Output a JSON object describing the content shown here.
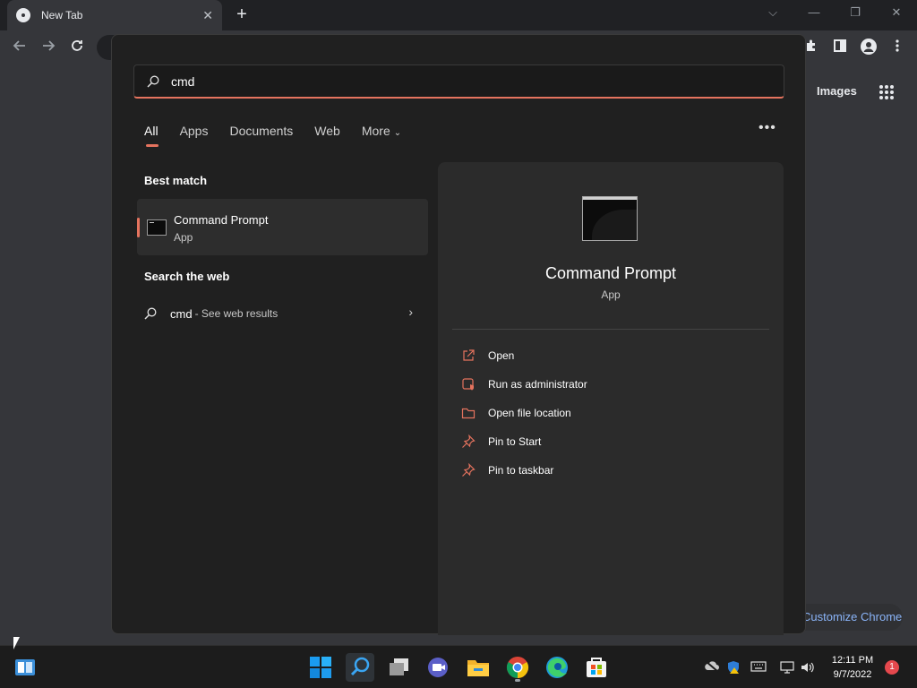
{
  "browser": {
    "tab_title": "New Tab",
    "tab_close": "✕",
    "new_tab": "+",
    "window_controls": {
      "dropdown": "⌵",
      "minimize": "—",
      "restore": "❐",
      "close": "✕"
    },
    "images_link": "Images",
    "customize_label": "Customize Chrome"
  },
  "search": {
    "query": "cmd",
    "filters": [
      "All",
      "Apps",
      "Documents",
      "Web",
      "More"
    ],
    "more_chevron": "⌄",
    "ellipsis": "•••",
    "best_match_title": "Best match",
    "best_match": {
      "name": "Command Prompt",
      "kind": "App"
    },
    "web_title": "Search the web",
    "web_result": {
      "query": "cmd",
      "suffix": "- See web results",
      "arrow": "›"
    },
    "accent_color": "#e5735e"
  },
  "detail": {
    "name": "Command Prompt",
    "kind": "App",
    "actions": [
      {
        "label": "Open",
        "icon": "open-icon"
      },
      {
        "label": "Run as administrator",
        "icon": "shield-icon"
      },
      {
        "label": "Open file location",
        "icon": "folder-icon"
      },
      {
        "label": "Pin to Start",
        "icon": "pin-icon"
      },
      {
        "label": "Pin to taskbar",
        "icon": "pin-icon"
      }
    ]
  },
  "taskbar": {
    "apps": [
      "start",
      "search",
      "task-view",
      "teams-chat",
      "file-explorer",
      "chrome",
      "edge",
      "microsoft-store"
    ],
    "clock_time": "12:11 PM",
    "clock_date": "9/7/2022",
    "notification_count": "1"
  }
}
